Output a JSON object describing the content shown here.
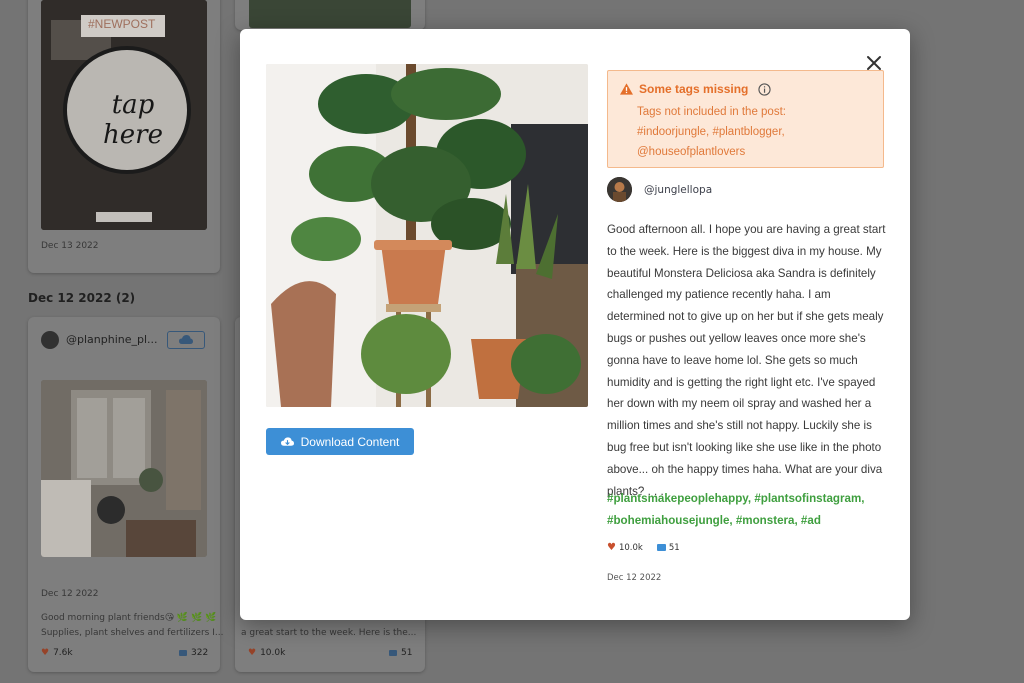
{
  "background": {
    "card1": {
      "sticker_hashtag": "#NEWPOST",
      "sticker_text": "tap here",
      "date": "Dec 13 2022"
    },
    "section_title": "Dec 12 2022 (2)",
    "card2": {
      "handle": "@planphine_pl...",
      "date": "Dec 12 2022",
      "caption_line1": "Good morning plant friends😘 🌿 🌿 🌿",
      "caption_line2": "Supplies, plant shelves and fertilizers I...",
      "likes": "7.6k",
      "comments": "322"
    },
    "card3": {
      "caption_line": "a great start to the week. Here is the...",
      "likes": "10.0k",
      "comments": "51"
    }
  },
  "modal": {
    "download_label": "Download Content",
    "warning": {
      "title": "Some tags missing",
      "lines": [
        "Tags not included in the post:",
        "#indoorjungle, #plantblogger,",
        "@houseofplantlovers"
      ]
    },
    "poster_handle": "@junglellopa",
    "caption": "Good afternoon all. I hope you are having a great start to the week. Here is the biggest diva in my house. My beautiful Monstera Deliciosa aka Sandra is definitely challenged my patience recently haha. I am determined not to give up on her but if she gets mealy bugs or pushes out yellow leaves once more she's gonna have to leave home lol. She gets so much humidity and is getting the right light etc. I've spayed her down with my neem oil spray and washed her a million times and she's still not happy. Luckily she is bug free but isn't looking like she use like in the photo above... oh the happy times haha. What are your diva plants? . . .",
    "hashtags": "#plantsmakepeoplehappy, #plantsofinstagram, #bohemiahousejungle, #monstera, #ad",
    "likes": "10.0k",
    "comments": "51",
    "date": "Dec 12 2022"
  },
  "colors": {
    "accent_blue": "#3d8fd6",
    "warning_orange": "#e46f2a",
    "warning_bg": "#fde8d8",
    "hashtag_green": "#3f9f3f",
    "like_heart": "#c8502e",
    "comment_blue": "#3d8fd6"
  },
  "icons": [
    "warning-icon",
    "info-icon",
    "close-icon",
    "cloud-download-icon",
    "heart-icon",
    "comment-icon"
  ]
}
